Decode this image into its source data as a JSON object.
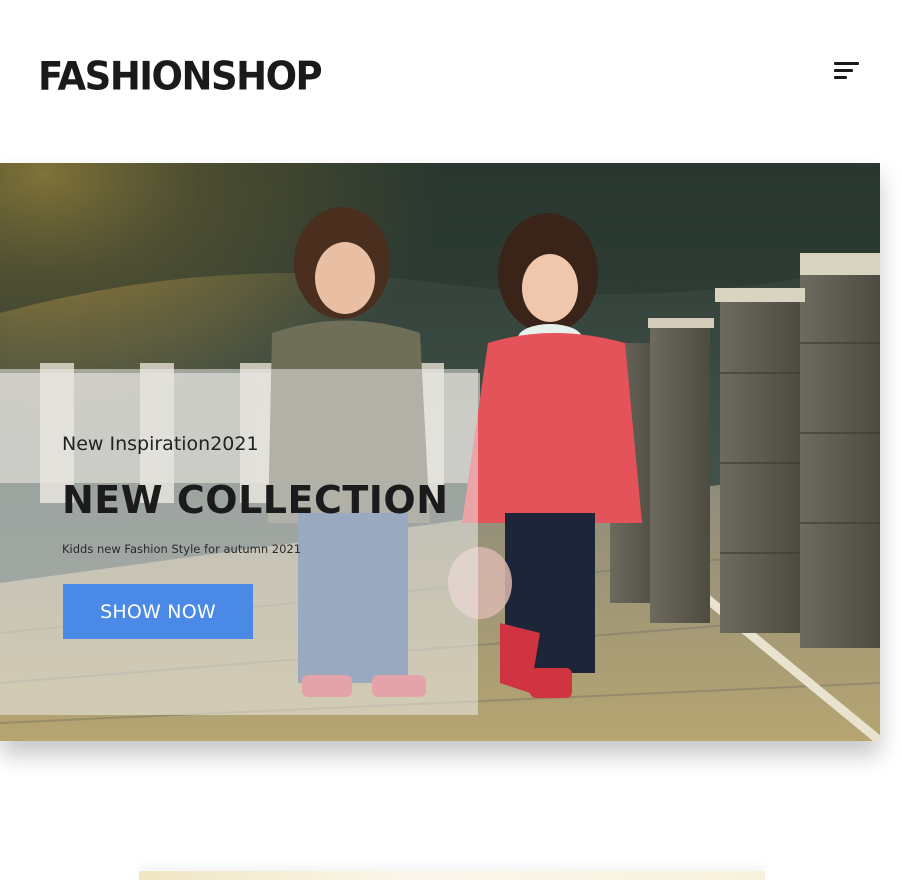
{
  "header": {
    "logo": "FASHIONSHOP",
    "menu_icon": "hamburger-menu-icon"
  },
  "hero": {
    "image": "two children walking on a paved path beside a stone fence",
    "kicker": "New Inspiration2021",
    "headline": "NEW COLLECTION",
    "subline": "Kidds new Fashion Style for autumn 2021",
    "cta_label": "SHOW NOW"
  },
  "colors": {
    "accent": "#4a8ae6",
    "text_dark": "#1a1a1a",
    "background": "#ffffff"
  }
}
